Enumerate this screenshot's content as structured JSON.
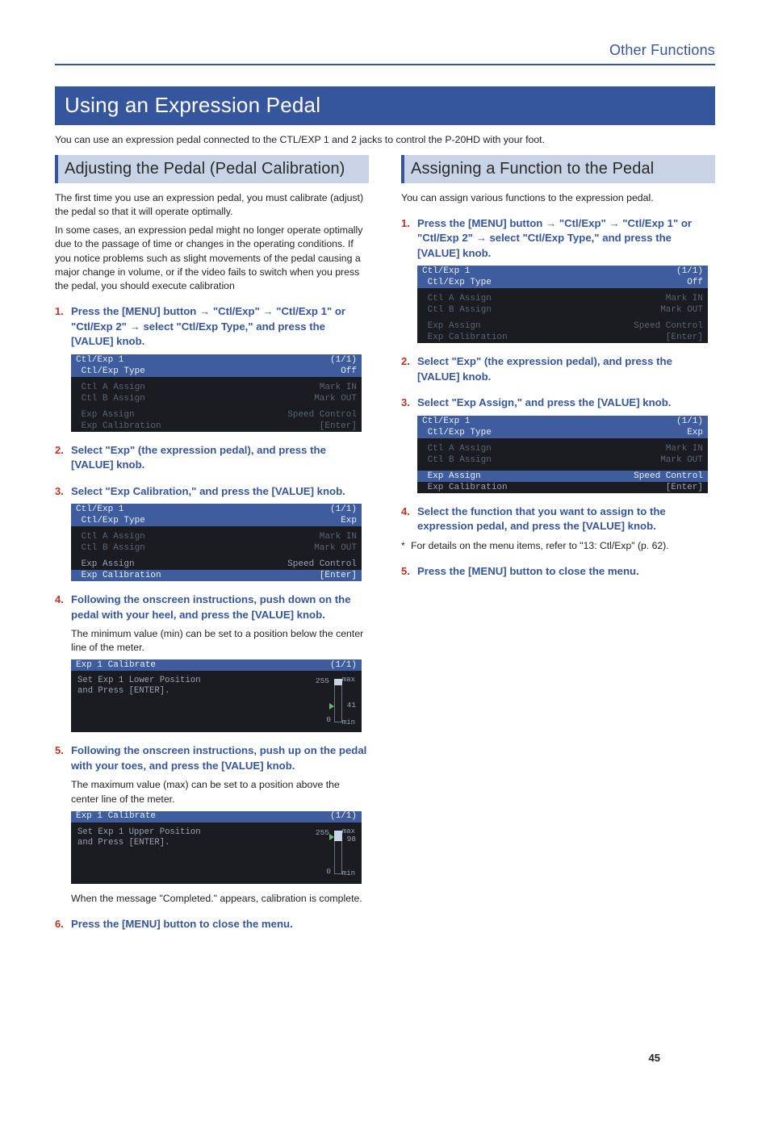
{
  "breadcrumb": "Other Functions",
  "section_title": "Using an Expression Pedal",
  "section_intro": "You can use an expression pedal connected to the CTL/EXP 1 and 2 jacks to control the P-20HD with your foot.",
  "left": {
    "sub_title": "Adjusting the Pedal (Pedal Calibration)",
    "p1": "The first time you use an expression pedal, you must calibrate (adjust) the pedal so that it will operate optimally.",
    "p2": "In some cases, an expression pedal might no longer operate optimally due to the passage of time or changes in the operating conditions. If you notice problems such as slight movements of the pedal causing a major change in volume, or if the video fails to switch when you press the pedal, you should execute calibration",
    "steps": {
      "s1": {
        "num": "1.",
        "body": "Press the [MENU] button → \"Ctl/Exp\" → \"Ctl/Exp 1\" or \"Ctl/Exp 2\" → select \"Ctl/Exp Type,\" and press the [VALUE] knob."
      },
      "s2": {
        "num": "2.",
        "body": "Select \"Exp\" (the expression pedal), and press the [VALUE] knob."
      },
      "s3": {
        "num": "3.",
        "body": "Select \"Exp Calibration,\" and press the [VALUE] knob."
      },
      "s4": {
        "num": "4.",
        "body": "Following the onscreen instructions, push down on the pedal with your heel, and press the [VALUE] knob.",
        "sub": "The minimum value (min) can be set to a position below the center line of the meter."
      },
      "s5": {
        "num": "5.",
        "body": "Following the onscreen instructions, push up on the pedal with your toes, and press the [VALUE] knob.",
        "sub": "The maximum value (max) can be set to a position above the center line of the meter."
      },
      "s5b": "When the message \"Completed.\" appears, calibration is complete.",
      "s6": {
        "num": "6.",
        "body": "Press the [MENU] button to close the menu."
      }
    },
    "scr1": {
      "hdr_l": "Ctl/Exp 1",
      "hdr_r": "(1/1)",
      "rows": [
        {
          "l": " Ctl/Exp Type",
          "r": "Off",
          "hl": true
        },
        {
          "l": " Ctl A Assign",
          "r": "Mark IN",
          "dim": true
        },
        {
          "l": " Ctl B Assign",
          "r": "Mark OUT",
          "dim": true
        },
        {
          "l": " Exp Assign",
          "r": "Speed Control",
          "dim": true
        },
        {
          "l": " Exp Calibration",
          "r": "[Enter]",
          "dim": true
        }
      ]
    },
    "scr2": {
      "hdr_l": "Ctl/Exp 1",
      "hdr_r": "(1/1)",
      "rows": [
        {
          "l": " Ctl/Exp Type",
          "r": "Exp",
          "hl": true
        },
        {
          "l": " Ctl A Assign",
          "r": "Mark IN",
          "dim": true
        },
        {
          "l": " Ctl B Assign",
          "r": "Mark OUT",
          "dim": true
        },
        {
          "l": " Exp Assign",
          "r": "Speed Control"
        },
        {
          "l": " Exp Calibration",
          "r": "[Enter]",
          "hl": true
        }
      ]
    },
    "cal1": {
      "hdr_l": "Exp 1 Calibrate",
      "hdr_r": "(1/1)",
      "text1": "Set Exp 1 Lower Position",
      "text2": "and Press [ENTER].",
      "max": "max",
      "min": "min",
      "v255": "255",
      "v0": "0",
      "read": "41"
    },
    "cal2": {
      "hdr_l": "Exp 1 Calibrate",
      "hdr_r": "(1/1)",
      "text1": "Set Exp 1 Upper Position",
      "text2": "and Press [ENTER].",
      "max": "max",
      "min": "min",
      "v255": "255",
      "v0": "0",
      "read": "98"
    }
  },
  "right": {
    "sub_title": "Assigning a Function to the Pedal",
    "p1": "You can assign various functions to the expression pedal.",
    "steps": {
      "s1": {
        "num": "1.",
        "body": "Press the [MENU] button → \"Ctl/Exp\" → \"Ctl/Exp 1\" or \"Ctl/Exp 2\" → select \"Ctl/Exp Type,\" and press the [VALUE] knob."
      },
      "s2": {
        "num": "2.",
        "body": "Select \"Exp\" (the expression pedal), and press the [VALUE] knob."
      },
      "s3": {
        "num": "3.",
        "body": "Select \"Exp Assign,\" and press the [VALUE] knob."
      },
      "s4": {
        "num": "4.",
        "body": "Select the function that you want to assign to the expression pedal, and press the [VALUE] knob."
      },
      "note": "For details on the menu items, refer to \"13: Ctl/Exp\" (p. 62).",
      "s5": {
        "num": "5.",
        "body": "Press the [MENU] button to close the menu."
      }
    },
    "scr1": {
      "hdr_l": "Ctl/Exp 1",
      "hdr_r": "(1/1)",
      "rows": [
        {
          "l": " Ctl/Exp Type",
          "r": "Off",
          "hl": true
        },
        {
          "l": " Ctl A Assign",
          "r": "Mark IN",
          "dim": true
        },
        {
          "l": " Ctl B Assign",
          "r": "Mark OUT",
          "dim": true
        },
        {
          "l": " Exp Assign",
          "r": "Speed Control",
          "dim": true
        },
        {
          "l": " Exp Calibration",
          "r": "[Enter]",
          "dim": true
        }
      ]
    },
    "scr2": {
      "hdr_l": "Ctl/Exp 1",
      "hdr_r": "(1/1)",
      "rows": [
        {
          "l": " Ctl/Exp Type",
          "r": "Exp",
          "hl": true
        },
        {
          "l": " Ctl A Assign",
          "r": "Mark IN",
          "dim": true
        },
        {
          "l": " Ctl B Assign",
          "r": "Mark OUT",
          "dim": true
        },
        {
          "l": " Exp Assign",
          "r": "Speed Control",
          "hl": true
        },
        {
          "l": " Exp Calibration",
          "r": "[Enter]"
        }
      ]
    }
  },
  "page_num": "45"
}
